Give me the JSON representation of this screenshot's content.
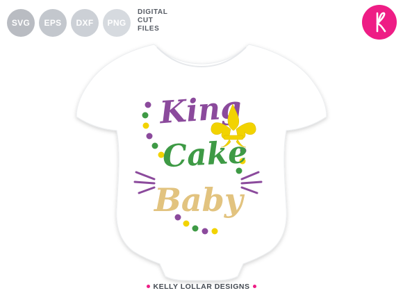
{
  "formats": [
    {
      "label": "SVG",
      "color": "#b9bcc2"
    },
    {
      "label": "EPS",
      "color": "#c3c7cd"
    },
    {
      "label": "DXF",
      "color": "#ccd0d6"
    },
    {
      "label": "PNG",
      "color": "#d6dadf"
    }
  ],
  "file_note": {
    "line1": "DIGITAL",
    "line2": "CUT",
    "line3": "FILES"
  },
  "logo": {
    "letter": "K",
    "color": "#ee1d85"
  },
  "design": {
    "word1": "King",
    "word2": "Cake",
    "word3": "Baby",
    "colors": {
      "purple": "#8b4a9c",
      "green": "#3e9a45",
      "gold": "#f2d300",
      "tan": "#e2c37f"
    },
    "fleur_icon": "fleur-de-lis-icon"
  },
  "footer": {
    "brand": "KELLY LOLLAR DESIGNS"
  }
}
